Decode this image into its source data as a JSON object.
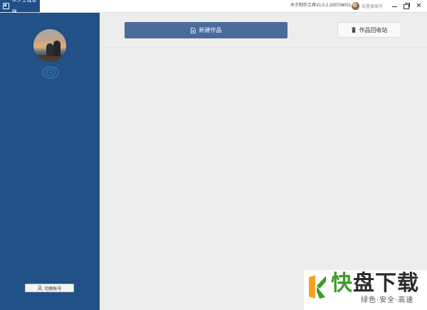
{
  "titlebar": {
    "app_title": "木夕工程管理",
    "version": "木夕制作工具V1.0.2.200706001",
    "user_name": "未登录账号"
  },
  "sidebar": {
    "switch_account_label": "切换账号"
  },
  "main": {
    "new_work_label": "新建作品",
    "recycle_label": "作品回收站"
  },
  "watermark": {
    "brand_first": "快",
    "brand_rest": "盘下载",
    "tagline": "绿色·安全·高速"
  },
  "colors": {
    "sidebar": "#215186",
    "primary_button": "#4a6a9b",
    "content_bg": "#ededed"
  },
  "icons": [
    "app-logo-icon",
    "user-avatar",
    "minimize-icon",
    "restore-icon",
    "close-icon",
    "refresh-icon",
    "user-outline-icon",
    "file-plus-icon",
    "trash-icon"
  ]
}
